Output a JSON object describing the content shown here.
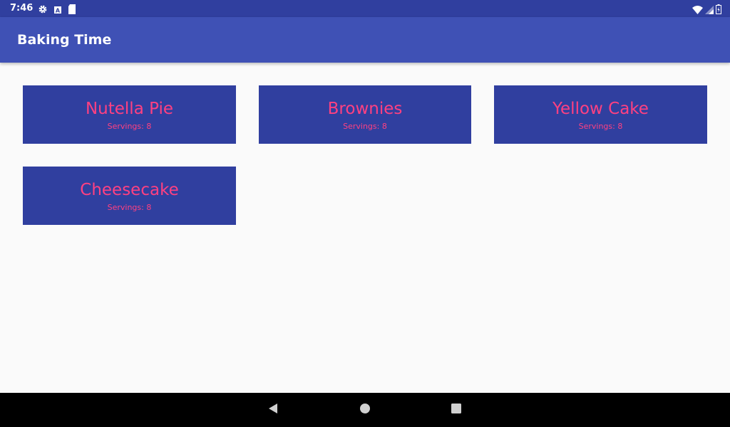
{
  "status_bar": {
    "time": "7:46",
    "icons_left": [
      "gear-icon",
      "accessibility-a-icon",
      "sd-card-icon"
    ],
    "icons_right": [
      "wifi-icon",
      "signal-icon",
      "battery-icon"
    ]
  },
  "app_bar": {
    "title": "Baking Time"
  },
  "recipes": [
    {
      "name": "Nutella Pie",
      "servings": "Servings: 8"
    },
    {
      "name": "Brownies",
      "servings": "Servings: 8"
    },
    {
      "name": "Yellow Cake",
      "servings": "Servings: 8"
    },
    {
      "name": "Cheesecake",
      "servings": "Servings: 8"
    }
  ],
  "nav_bar": {
    "buttons": [
      "back-icon",
      "home-icon",
      "recents-icon"
    ]
  },
  "colors": {
    "status_bar": "#303f9f",
    "app_bar": "#3f51b5",
    "card": "#303f9f",
    "accent": "#ff4081",
    "background": "#fafafa"
  }
}
